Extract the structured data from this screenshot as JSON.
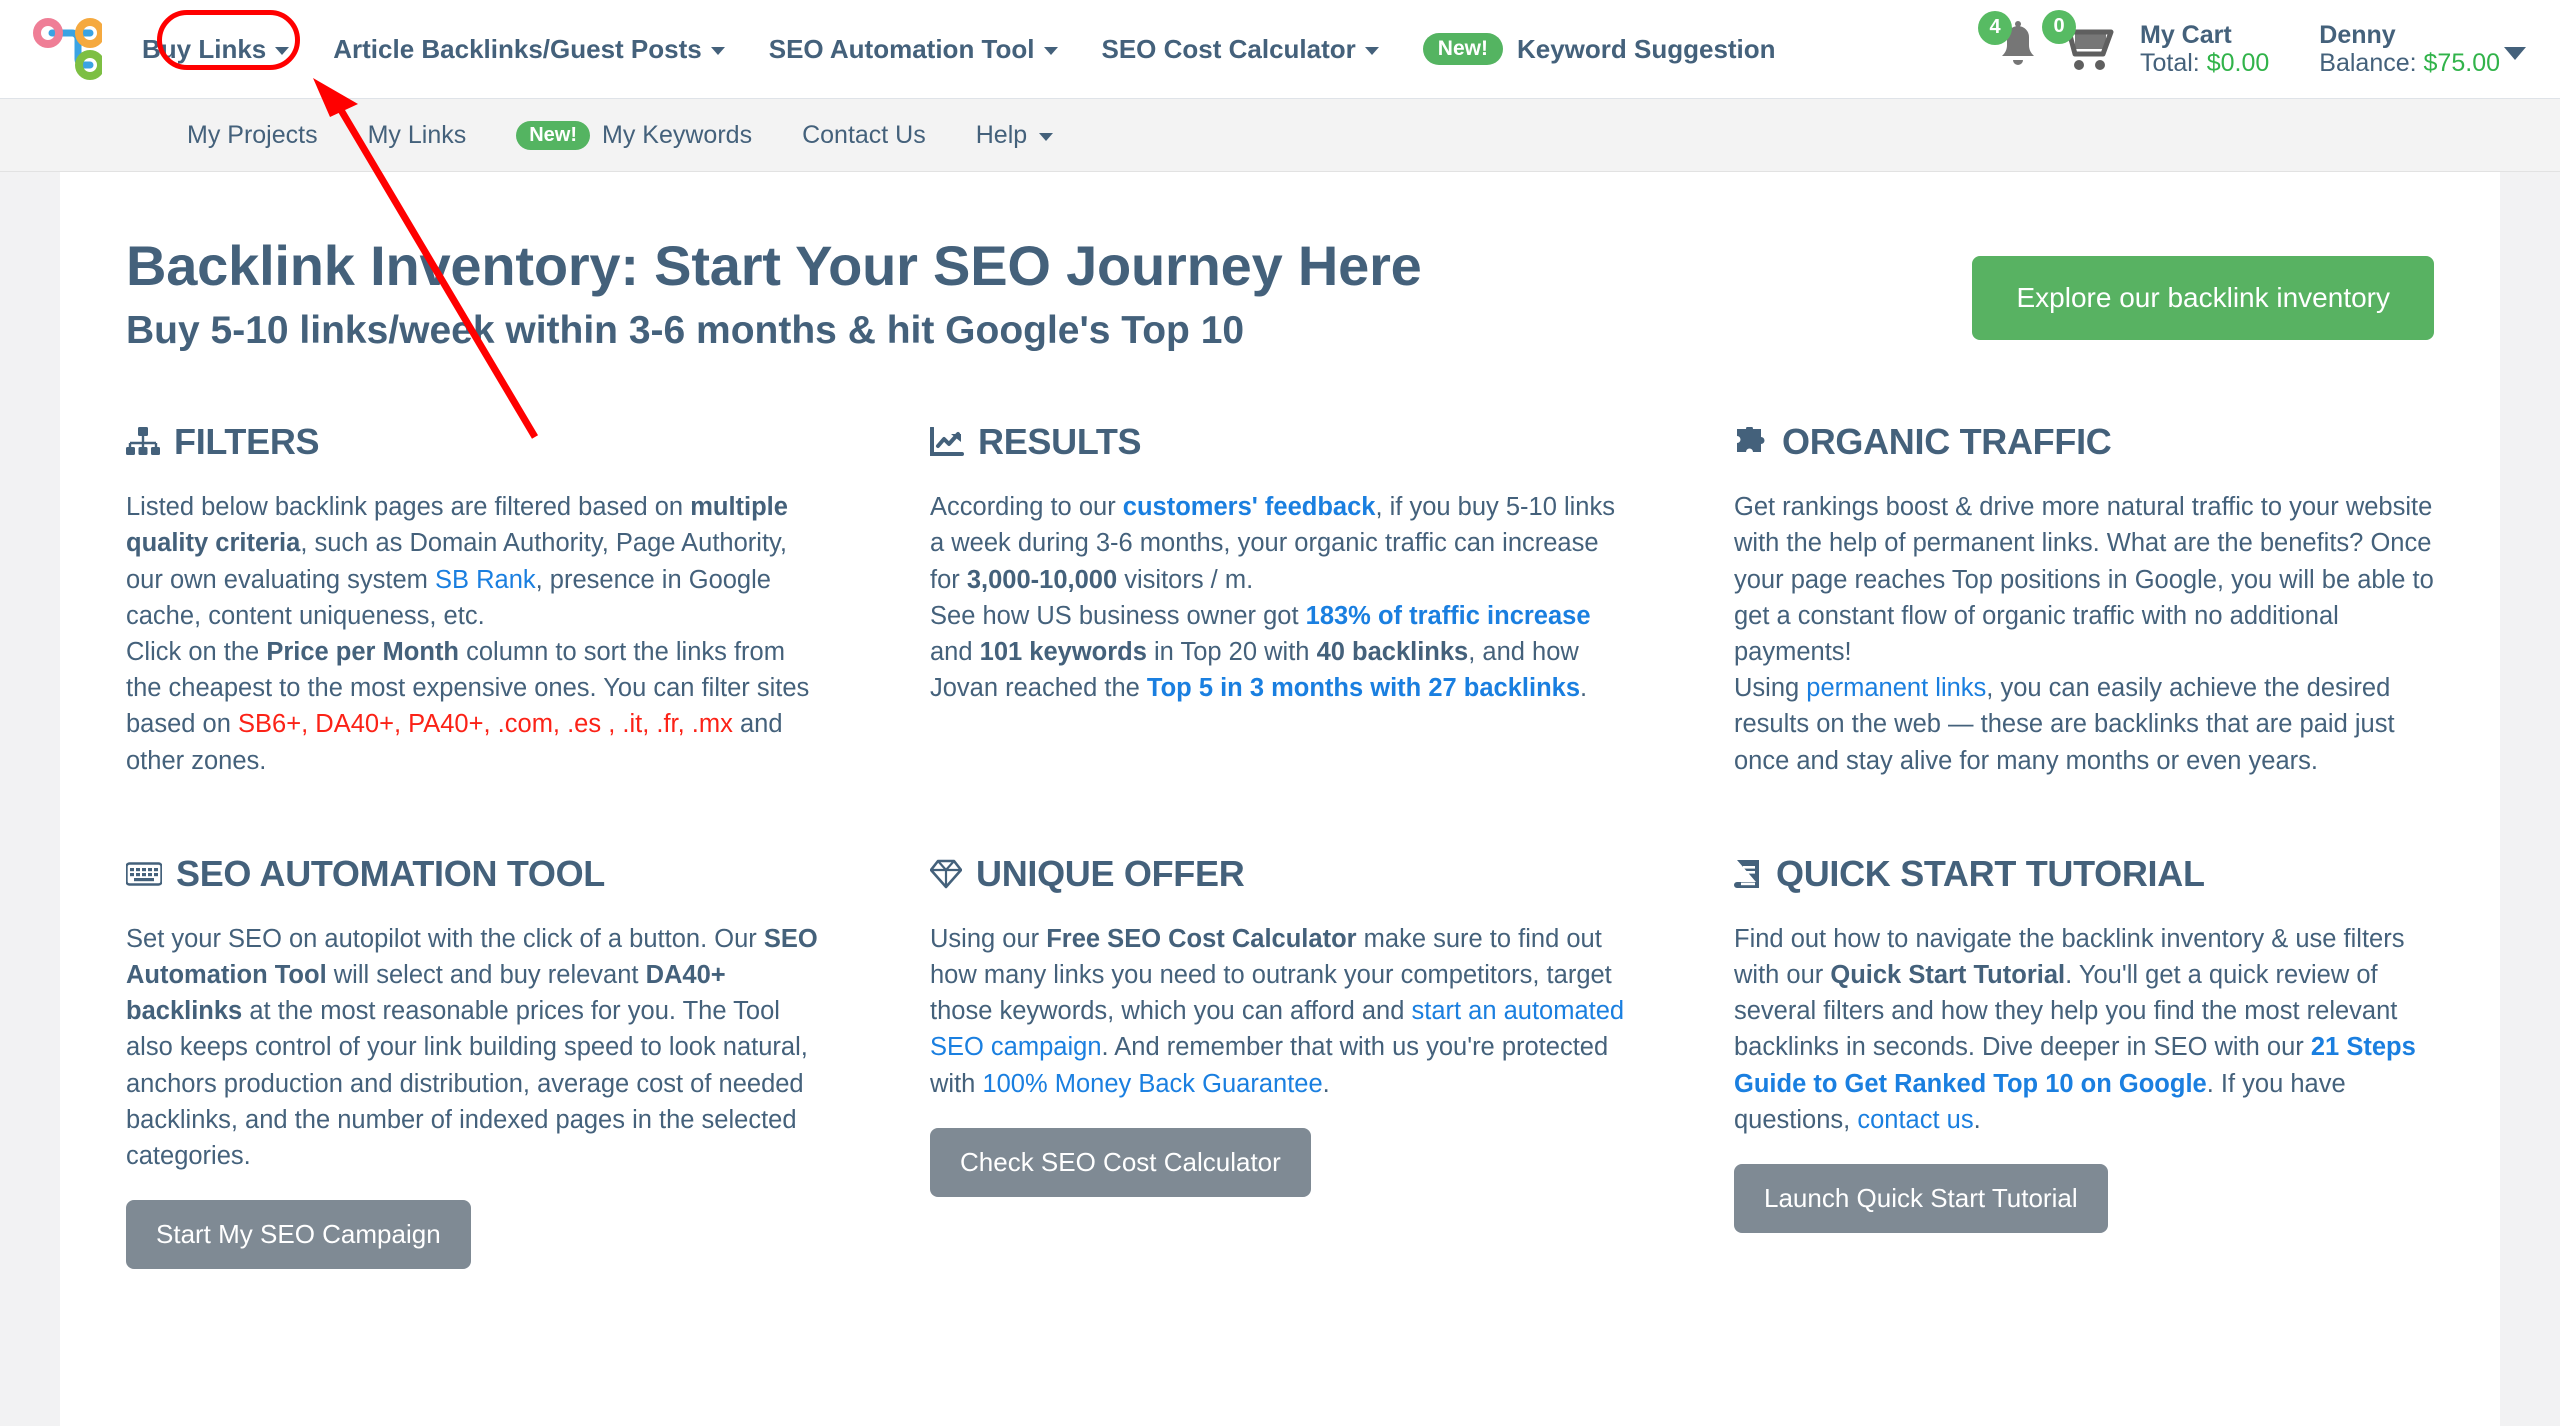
{
  "colors": {
    "brand_navy": "#44617b",
    "green": "#58b262",
    "link_blue": "#1a7fe0",
    "red_accent": "#fb2217",
    "gray_button": "#7f8a94",
    "annotation_red": "#ff0000"
  },
  "topnav": {
    "logo_name": "sitebacklinks-logo",
    "items": [
      {
        "label": "Buy Links",
        "caret": true,
        "pill": null
      },
      {
        "label": "Article Backlinks/Guest Posts",
        "caret": true,
        "pill": null
      },
      {
        "label": "SEO Automation Tool",
        "caret": true,
        "pill": null
      },
      {
        "label": "SEO Cost Calculator",
        "caret": true,
        "pill": null
      },
      {
        "label": "Keyword Suggestion",
        "caret": false,
        "pill": "New!"
      }
    ],
    "notifications_count": "4",
    "cart_count": "0",
    "cart_label": "My Cart",
    "cart_total_label": "Total:",
    "cart_total_value": "$0.00",
    "user_name": "Denny",
    "balance_label": "Balance:",
    "balance_value": "$75.00"
  },
  "subnav": {
    "items": [
      {
        "label": "My Projects",
        "caret": false,
        "pill": null
      },
      {
        "label": "My Links",
        "caret": false,
        "pill": null
      },
      {
        "label": "My Keywords",
        "caret": false,
        "pill": "New!"
      },
      {
        "label": "Contact Us",
        "caret": false,
        "pill": null
      },
      {
        "label": "Help",
        "caret": true,
        "pill": null
      }
    ]
  },
  "hero": {
    "title": "Backlink Inventory: Start Your SEO Journey Here",
    "subtitle": "Buy 5-10 links/week within 3-6 months & hit Google's Top 10",
    "cta_label": "Explore our backlink inventory"
  },
  "cards": {
    "filters": {
      "icon": "sitemap-icon",
      "heading": "FILTERS",
      "p1_a": "Listed below backlink pages are filtered based on ",
      "p1_b": "multiple quality criteria",
      "p1_c": ", such as Domain Authority, Page Authority, our own evaluating system ",
      "p1_d": "SB Rank",
      "p1_e": ", presence in Google cache, content uniqueness, etc.",
      "p2_a": "Click on the ",
      "p2_b": "Price per Month",
      "p2_c": " column to sort the links from the cheapest to the most expensive ones. You can filter sites based on ",
      "p2_d": "SB6+, DA40+, PA40+, .com, .es , .it, .fr, .mx",
      "p2_e": " and other zones."
    },
    "results": {
      "icon": "chart-line-icon",
      "heading": "RESULTS",
      "p1_a": "According to our ",
      "p1_b": "customers' feedback",
      "p1_c": ", if you buy 5-10 links a week during 3-6 months, your organic traffic can increase for ",
      "p1_d": "3,000-10,000",
      "p1_e": " visitors / m.",
      "p2_a": "See how US business owner got ",
      "p2_b": "183% of traffic increase",
      "p2_c": " and ",
      "p2_d": "101 keywords",
      "p2_e": " in Top 20 with ",
      "p2_f": "40 backlinks",
      "p2_g": ", and how Jovan reached the ",
      "p2_h": "Top 5 in 3 months with 27 backlinks",
      "p2_i": "."
    },
    "organic": {
      "icon": "puzzle-piece-icon",
      "heading": "ORGANIC TRAFFIC",
      "p1": "Get rankings boost & drive more natural traffic to your website with the help of permanent links. What are the benefits? Once your page reaches Top positions in Google, you will be able to get a constant flow of organic traffic with no additional payments!",
      "p2_a": "Using ",
      "p2_b": "permanent links",
      "p2_c": ", you can easily achieve the desired results on the web — these are backlinks that are paid just once and stay alive for many months or even years."
    },
    "automation": {
      "icon": "keyboard-icon",
      "heading": "SEO AUTOMATION TOOL",
      "p1_a": "Set your SEO on autopilot with the click of a button. Our ",
      "p1_b": "SEO Automation Tool",
      "p1_c": " will select and buy relevant ",
      "p1_d": "DA40+ backlinks",
      "p1_e": " at the most reasonable prices for you. The Tool also keeps control of your link building speed to look natural, anchors production and distribution, average cost of needed backlinks, and the number of indexed pages in the selected categories.",
      "button_label": "Start My SEO Campaign"
    },
    "offer": {
      "icon": "gem-icon",
      "heading": "UNIQUE OFFER",
      "p1_a": "Using our ",
      "p1_b": "Free SEO Cost Calculator",
      "p1_c": " make sure to find out how many links you need to outrank your competitors, target those keywords, which you can afford and ",
      "p1_d": "start an automated SEO campaign",
      "p1_e": ". And remember that with us you're protected with ",
      "p1_f": "100% Money Back Guarantee",
      "p1_g": ".",
      "button_label": "Check SEO Cost Calculator"
    },
    "tutorial": {
      "icon": "book-icon",
      "heading": "QUICK START TUTORIAL",
      "p1_a": "Find out how to navigate the backlink inventory & use filters with our ",
      "p1_b": "Quick Start Tutorial",
      "p1_c": ". You'll get a quick review of several filters and how they help you find the most relevant backlinks in seconds. Dive deeper in SEO with our ",
      "p1_d": "21 Steps Guide to Get Ranked Top 10 on Google",
      "p1_e": ". If you have questions, ",
      "p1_f": "contact us",
      "p1_g": ".",
      "button_label": "Launch Quick Start Tutorial"
    }
  },
  "annotation": {
    "target": "Buy Links",
    "shape": "rounded-rectangle-highlight",
    "arrow": "red-arrow-pointing-to-buy-links"
  }
}
